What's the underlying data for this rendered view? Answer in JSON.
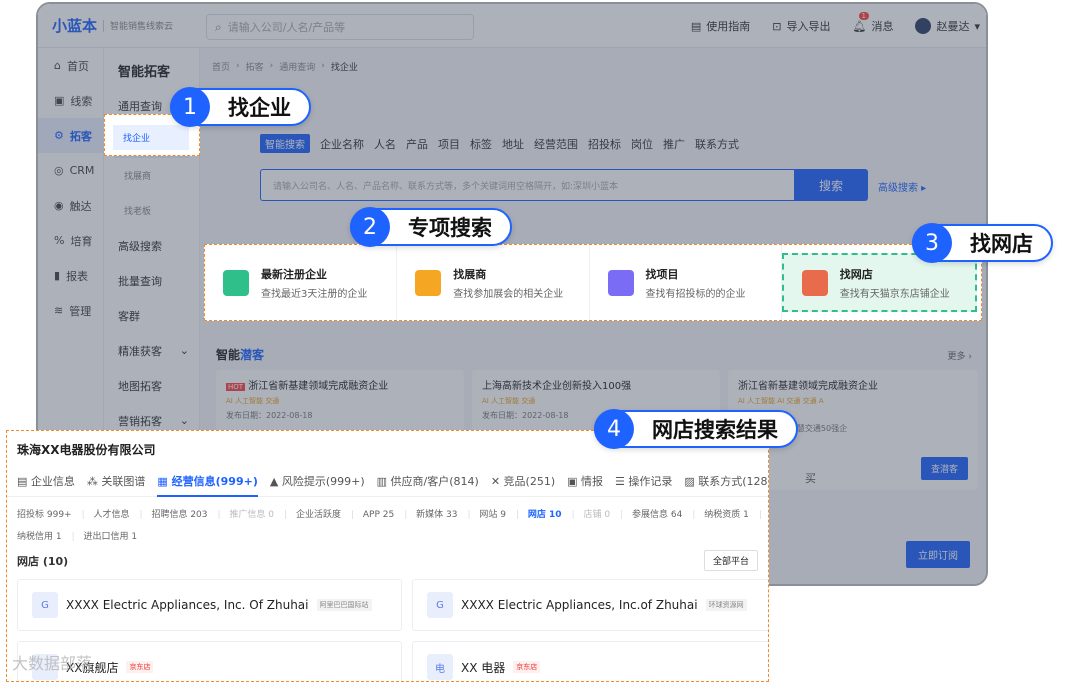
{
  "app": {
    "logo": "小蓝本",
    "logo_sub": "智能销售线索云"
  },
  "topbar": {
    "search_placeholder": "请输入公司/人名/产品等",
    "actions": [
      {
        "label": "使用指南",
        "icon": "book-icon"
      },
      {
        "label": "导入导出",
        "icon": "import-export-icon"
      },
      {
        "label": "消息",
        "icon": "bell-icon",
        "badge": "1"
      }
    ],
    "user": "赵曼达"
  },
  "sidebar": {
    "items": [
      {
        "label": "首页",
        "icon": "home-icon"
      },
      {
        "label": "线索",
        "icon": "leads-icon"
      },
      {
        "label": "拓客",
        "icon": "gear-icon",
        "active": true
      },
      {
        "label": "CRM",
        "icon": "crm-icon"
      },
      {
        "label": "触达",
        "icon": "target-icon"
      },
      {
        "label": "培育",
        "icon": "nurture-icon"
      },
      {
        "label": "报表",
        "icon": "report-icon"
      },
      {
        "label": "管理",
        "icon": "layers-icon"
      }
    ]
  },
  "subnav": {
    "title": "智能拓客",
    "items": [
      {
        "label": "通用查询"
      },
      {
        "label": "找企业",
        "sub": true,
        "active": true
      },
      {
        "label": "找展商",
        "sub": true
      },
      {
        "label": "找老板",
        "sub": true
      },
      {
        "label": "高级搜索"
      },
      {
        "label": "批量查询"
      },
      {
        "label": "客群"
      },
      {
        "label": "精准获客",
        "chevron": true
      },
      {
        "label": "地图拓客"
      },
      {
        "label": "营销拓客",
        "chevron": true
      }
    ]
  },
  "breadcrumb": [
    "首页",
    "拓客",
    "通用查询",
    "找企业"
  ],
  "search_tabs": [
    "智能搜索",
    "企业名称",
    "人名",
    "产品",
    "项目",
    "标签",
    "地址",
    "经营范围",
    "招投标",
    "岗位",
    "推广",
    "联系方式"
  ],
  "main_search": {
    "placeholder": "请输入公司名、人名、产品名称、联系方式等，多个关键词用空格隔开，如:深圳小蓝本",
    "button": "搜索",
    "advanced": "高级搜索 ▸"
  },
  "features": [
    {
      "title": "最新注册企业",
      "desc": "查找最近3天注册的企业",
      "color": "#2fbf8a"
    },
    {
      "title": "找展商",
      "desc": "查找参加展会的相关企业",
      "color": "#f5a623"
    },
    {
      "title": "找项目",
      "desc": "查找有招投标的的企业",
      "color": "#7b6cf6"
    },
    {
      "title": "找网店",
      "desc": "查找有天猫京东店铺企业",
      "color": "#e86c4c"
    }
  ],
  "callouts": [
    {
      "num": "1",
      "text": "找企业"
    },
    {
      "num": "2",
      "text": "专项搜索"
    },
    {
      "num": "3",
      "text": "找网店"
    },
    {
      "num": "4",
      "text": "网店搜索结果"
    }
  ],
  "smart": {
    "title_a": "智能",
    "title_b": "潜客",
    "more": "更多 ›",
    "cards": [
      {
        "hot": "HOT",
        "title": "浙江省新基建领域完成融资企业",
        "tags": "AI 人工智能 交通",
        "date": "发布日期：2022-08-18"
      },
      {
        "title": "上海高新技术企业创新投入100强",
        "tags": "AI 人工智能 交通",
        "date": "发布日期：2022-08-18"
      },
      {
        "title": "浙江省新基建领域完成融资企业",
        "tags": "AI 人工智能 AI 交通 交通 A",
        "date": "18",
        "extra": "的2021年AI+智慧交通50强企",
        "button": "查潜客"
      }
    ],
    "subscribe": "立即订阅",
    "buy": "买"
  },
  "result": {
    "company": "珠海XX电器股份有限公司",
    "tabs": [
      {
        "label": "企业信息",
        "icon": "info-icon"
      },
      {
        "label": "关联图谱",
        "icon": "graph-icon"
      },
      {
        "label": "经营信息(999+)",
        "icon": "business-icon",
        "active": true
      },
      {
        "label": "风险提示(999+)",
        "icon": "risk-icon"
      },
      {
        "label": "供应商/客户(814)",
        "icon": "supplier-icon"
      },
      {
        "label": "竞品(251)",
        "icon": "compete-icon"
      },
      {
        "label": "情报",
        "icon": "intel-icon"
      },
      {
        "label": "操作记录",
        "icon": "record-icon"
      },
      {
        "label": "联系方式(128)",
        "icon": "contact-icon"
      }
    ],
    "subtabs_row1": [
      {
        "label": "招投标 999+"
      },
      {
        "label": "人才信息"
      },
      {
        "label": "招聘信息 203"
      },
      {
        "label": "推广信息 0",
        "dim": true
      },
      {
        "label": "企业活跃度"
      },
      {
        "label": "APP 25"
      },
      {
        "label": "新媒体 33"
      },
      {
        "label": "网站 9"
      },
      {
        "label": "网店 10",
        "on": true
      },
      {
        "label": "店铺 0",
        "dim": true
      },
      {
        "label": "参展信息 64"
      },
      {
        "label": "纳税资质 1"
      }
    ],
    "subtabs_row2": [
      {
        "label": "纳税信用 1"
      },
      {
        "label": "进出口信用 1"
      }
    ],
    "shop_count": "网店 (10)",
    "platform": "全部平台",
    "shops": [
      {
        "logo": "G",
        "name": "XXXX Electric Appliances, Inc. Of Zhuhai",
        "tag": "阿里巴巴国际站",
        "jd": false
      },
      {
        "logo": "G",
        "name": "XXXX Electric Appliances, Inc.of Zhuhai",
        "tag": "环球资源网",
        "jd": false
      },
      {
        "logo": "",
        "name": "XX旗舰店",
        "tag": "京东店",
        "jd": true
      },
      {
        "logo": "电",
        "name": "XX 电器",
        "tag": "京东店",
        "jd": true
      }
    ]
  },
  "watermark": "大数据部落"
}
